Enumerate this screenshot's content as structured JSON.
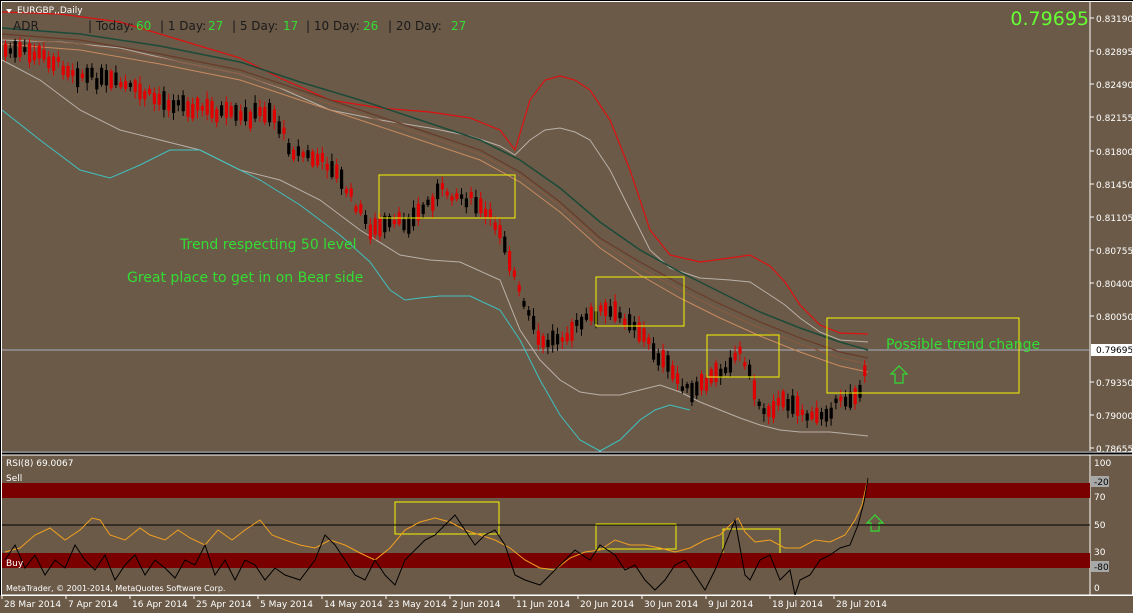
{
  "symbol_title": "EURGBP,,Daily",
  "current_price": "0.79695",
  "adr": {
    "label": "ADR",
    "today_label": "| Today:",
    "today_value": "60",
    "day1_label": "| 1 Day:",
    "day1_value": "27",
    "day5_label": "| 5 Day:",
    "day5_value": "17",
    "day10_label": "| 10 Day:",
    "day10_value": "26",
    "day20_label": "| 20 Day:",
    "day20_value": "27"
  },
  "annotations": {
    "trend_respect": "Trend respecting 50 level",
    "bear_entry": "Great place to get in on Bear side",
    "trend_change": "Possible trend change"
  },
  "price_axis": [
    "0.83190",
    "0.82895",
    "0.82490",
    "0.82155",
    "0.81800",
    "0.81450",
    "0.81105",
    "0.80755",
    "0.80400",
    "0.80050",
    "0.79695",
    "0.79350",
    "0.79000",
    "0.78655"
  ],
  "rsi": {
    "title": "RSI(8) 69.0067",
    "sell_label": "Sell",
    "buy_label": "Buy",
    "axis_labels": [
      "100",
      "-20",
      "70",
      "50",
      "30",
      "-80",
      "0"
    ]
  },
  "date_axis": [
    "28 Mar 2014",
    "7 Apr 2014",
    "16 Apr 2014",
    "25 Apr 2014",
    "5 May 2014",
    "14 May 2014",
    "23 May 2014",
    "2 Jun 2014",
    "11 Jun 2014",
    "20 Jun 2014",
    "30 Jun 2014",
    "9 Jul 2014",
    "18 Jul 2014",
    "28 Jul 2014"
  ],
  "copyright": "MetaTrader, © 2001-2014, MetaQuotes Software Corp.",
  "colors": {
    "background": "#6b5a48",
    "bull_candle": "#000000",
    "bear_candle": "#e00000",
    "upper_band": "#e01010",
    "annotation_text": "#33dd33",
    "highlight_box": "#f5f500",
    "price_positive": "#66ff33"
  }
}
